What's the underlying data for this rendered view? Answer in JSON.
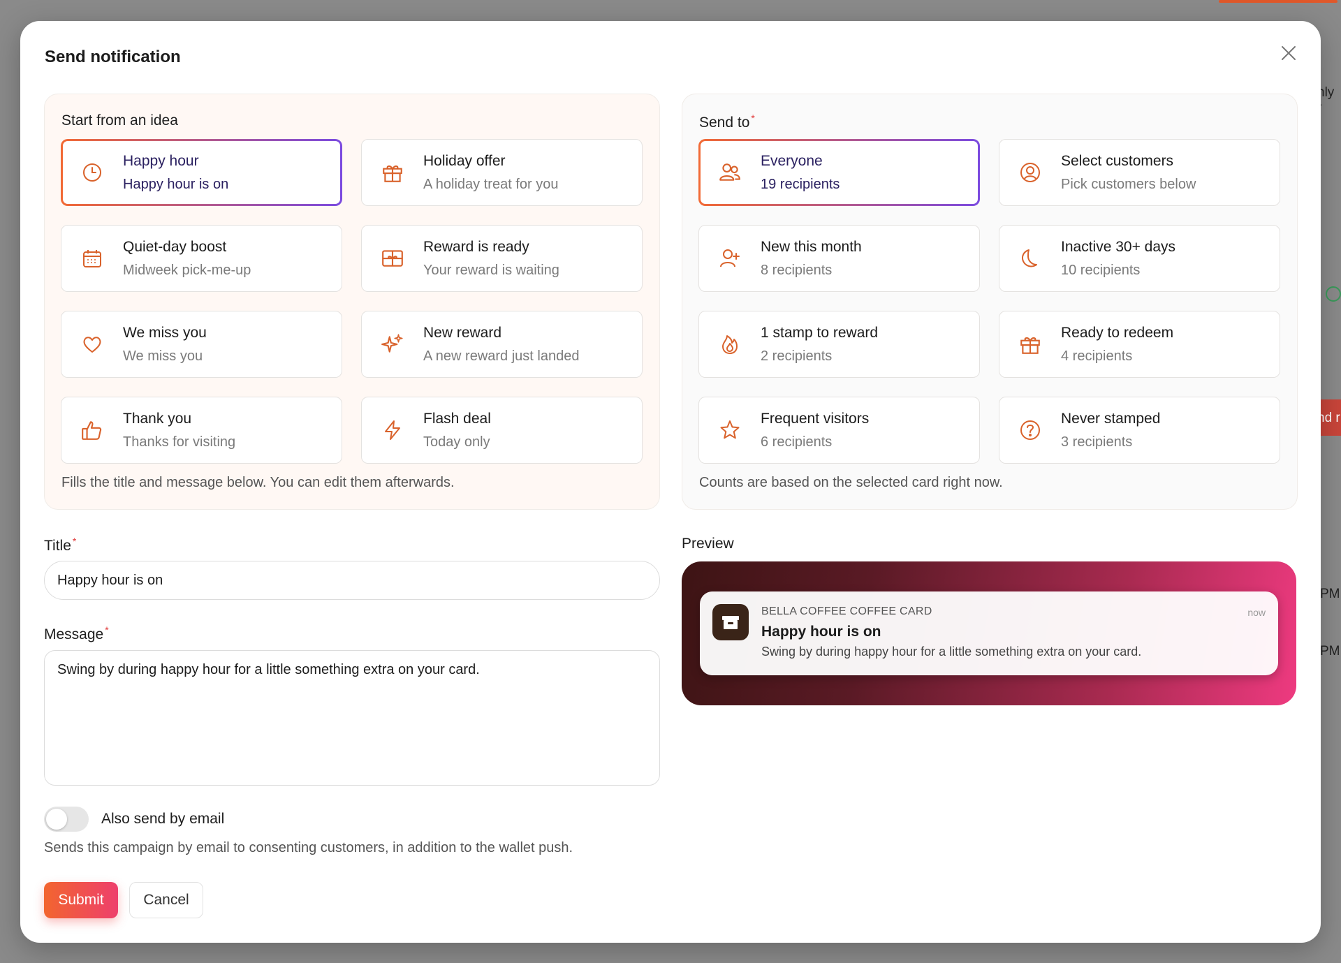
{
  "background": {
    "fragments": [
      "nly r",
      "nd r",
      "PM",
      "PM"
    ]
  },
  "modal": {
    "title": "Send notification"
  },
  "ideas": {
    "label": "Start from an idea",
    "note": "Fills the title and message below. You can edit them afterwards.",
    "items": [
      {
        "title": "Happy hour",
        "subtitle": "Happy hour is on",
        "icon": "clock-icon",
        "selected": true
      },
      {
        "title": "Holiday offer",
        "subtitle": "A holiday treat for you",
        "icon": "gift-icon",
        "selected": false
      },
      {
        "title": "Quiet-day boost",
        "subtitle": "Midweek pick-me-up",
        "icon": "calendar-icon",
        "selected": false
      },
      {
        "title": "Reward is ready",
        "subtitle": "Your reward is waiting",
        "icon": "gift-card-icon",
        "selected": false
      },
      {
        "title": "We miss you",
        "subtitle": "We miss you",
        "icon": "heart-icon",
        "selected": false
      },
      {
        "title": "New reward",
        "subtitle": "A new reward just landed",
        "icon": "sparkles-icon",
        "selected": false
      },
      {
        "title": "Thank you",
        "subtitle": "Thanks for visiting",
        "icon": "thumbs-up-icon",
        "selected": false
      },
      {
        "title": "Flash deal",
        "subtitle": "Today only",
        "icon": "lightning-icon",
        "selected": false
      }
    ]
  },
  "sendto": {
    "label": "Send to",
    "note": "Counts are based on the selected card right now.",
    "items": [
      {
        "title": "Everyone",
        "subtitle": "19 recipients",
        "icon": "users-icon",
        "selected": true
      },
      {
        "title": "Select customers",
        "subtitle": "Pick customers below",
        "icon": "user-circle-icon",
        "selected": false
      },
      {
        "title": "New this month",
        "subtitle": "8 recipients",
        "icon": "user-plus-icon",
        "selected": false
      },
      {
        "title": "Inactive 30+ days",
        "subtitle": "10 recipients",
        "icon": "moon-icon",
        "selected": false
      },
      {
        "title": "1 stamp to reward",
        "subtitle": "2 recipients",
        "icon": "flame-icon",
        "selected": false
      },
      {
        "title": "Ready to redeem",
        "subtitle": "4 recipients",
        "icon": "gift-icon",
        "selected": false
      },
      {
        "title": "Frequent visitors",
        "subtitle": "6 recipients",
        "icon": "star-icon",
        "selected": false
      },
      {
        "title": "Never stamped",
        "subtitle": "3 recipients",
        "icon": "help-circle-icon",
        "selected": false
      }
    ]
  },
  "form": {
    "title_label": "Title",
    "title_value": "Happy hour is on",
    "message_label": "Message",
    "message_value": "Swing by during happy hour for a little something extra on your card.",
    "email_toggle_label": "Also send by email",
    "email_toggle_on": false,
    "email_help": "Sends this campaign by email to consenting customers, in addition to the wallet push.",
    "submit_label": "Submit",
    "cancel_label": "Cancel"
  },
  "preview": {
    "label": "Preview",
    "app_name": "BELLA COFFEE COFFEE CARD",
    "time": "now",
    "title": "Happy hour is on",
    "body": "Swing by during happy hour for a little something extra on your card."
  },
  "colors": {
    "accent_orange": "#f26a35",
    "accent_purple": "#7b4be0",
    "icon_color": "#d9622b",
    "submit_start": "#f2652f",
    "submit_end": "#ee3f6c"
  }
}
